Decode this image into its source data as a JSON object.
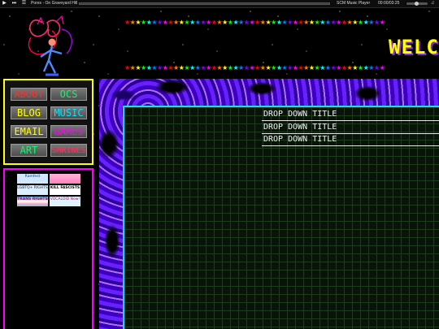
{
  "player": {
    "track": "Pores - On Graveyard Hill",
    "name": "SCM Music Player",
    "time": "00:00/03:25",
    "progress_fraction": 0.0
  },
  "header": {
    "welcome": "WELC",
    "star_colors": [
      "#ff0000",
      "#ff7f00",
      "#ffff00",
      "#00ff00",
      "#00ffff",
      "#0080ff",
      "#8000ff",
      "#ff00ff"
    ]
  },
  "nav": {
    "buttons": [
      {
        "label": "ABOUT",
        "color": "#ff3030"
      },
      {
        "label": "OCS",
        "color": "#00ff66"
      },
      {
        "label": "BLOG",
        "color": "#ffff00"
      },
      {
        "label": "MUSIC",
        "color": "#00e5ff"
      },
      {
        "label": "EMAIL",
        "color": "#ffff00"
      },
      {
        "label": "GAMES",
        "color": "#ff00ff"
      },
      {
        "label": "ART",
        "color": "#00ff66"
      },
      {
        "label": "SHRINES",
        "color": "#ff3060"
      }
    ]
  },
  "buttons88": [
    {
      "text": "Ramfest"
    },
    {
      "text": ""
    },
    {
      "text": "LGBTQ+ RIGHTS"
    },
    {
      "text": "KILL FASCISTS"
    },
    {
      "text": "TRANS RIGHTS"
    },
    {
      "text": "VOCALOID Now!"
    }
  ],
  "main": {
    "dropdowns": [
      {
        "title": "DROP DOWN TITLE"
      },
      {
        "title": "DROP DOWN TITLE"
      },
      {
        "title": "DROP DOWN TITLE"
      }
    ]
  }
}
